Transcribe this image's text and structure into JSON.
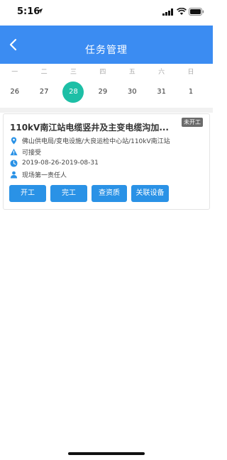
{
  "status_bar": {
    "time": "5:16"
  },
  "nav": {
    "title": "任务管理"
  },
  "calendar": {
    "weekdays": [
      "一",
      "二",
      "三",
      "四",
      "五",
      "六",
      "日"
    ],
    "days": [
      "26",
      "27",
      "28",
      "29",
      "30",
      "31",
      "1"
    ],
    "selected_day": "28"
  },
  "task": {
    "title": "110kV南江站电缆竖井及主变电缆沟加...",
    "status": "未开工",
    "location": "佛山供电局/变电设施/大良运检中心站/110kV南江站",
    "availability": "可接受",
    "date_range": "2019-08-26-2019-08-31",
    "owner": "现场第一责任人",
    "actions": [
      "开工",
      "完工",
      "查资质",
      "关联设备"
    ]
  },
  "colors": {
    "nav": "#3b8cf2",
    "selected_day": "#1dbfa6",
    "button": "#2a92e6",
    "badge": "#6b6b6b"
  },
  "icons": [
    "location-arrow-icon",
    "signal-icon",
    "wifi-icon",
    "battery-icon",
    "back-chevron-icon",
    "map-pin-icon",
    "warning-icon",
    "clock-icon",
    "person-icon"
  ]
}
